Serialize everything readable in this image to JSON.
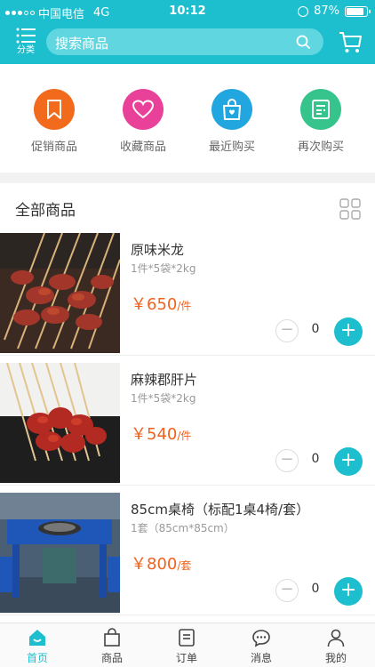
{
  "status_bar": {
    "carrier": "中国电信",
    "network": "4G",
    "time": "10:12",
    "battery": "87%"
  },
  "header": {
    "category_label": "分类",
    "search_placeholder": "搜索商品",
    "accent_color": "#1dbfcf"
  },
  "quick_links": [
    {
      "label": "促销商品",
      "icon": "bookmark-icon",
      "color": "#f26a1b"
    },
    {
      "label": "收藏商品",
      "icon": "heart-icon",
      "color": "#e9409a"
    },
    {
      "label": "最近购买",
      "icon": "shopping-bag-icon",
      "color": "#22a6e0"
    },
    {
      "label": "再次购买",
      "icon": "receipt-icon",
      "color": "#37c48c"
    }
  ],
  "section": {
    "title": "全部商品"
  },
  "products": [
    {
      "name": "原味米龙",
      "spec": "1件*5袋*2kg",
      "price": "￥650",
      "unit": "/件",
      "quantity": "0",
      "image": "beef-skewers-photo"
    },
    {
      "name": "麻辣郡肝片",
      "spec": "1件*5袋*2kg",
      "price": "￥540",
      "unit": "/件",
      "quantity": "0",
      "image": "spicy-gizzard-skewers-photo"
    },
    {
      "name": "85cm桌椅（标配1桌4椅/套）",
      "spec": "1套（85cm*85cm）",
      "price": "￥800",
      "unit": "/套",
      "quantity": "0",
      "image": "blue-table-photo"
    }
  ],
  "tabbar": [
    {
      "label": "首页",
      "icon": "home-icon",
      "active": true
    },
    {
      "label": "商品",
      "icon": "bag-icon",
      "active": false
    },
    {
      "label": "订单",
      "icon": "order-icon",
      "active": false
    },
    {
      "label": "消息",
      "icon": "message-icon",
      "active": false
    },
    {
      "label": "我的",
      "icon": "user-icon",
      "active": false
    }
  ],
  "price_color": "#f2611d"
}
